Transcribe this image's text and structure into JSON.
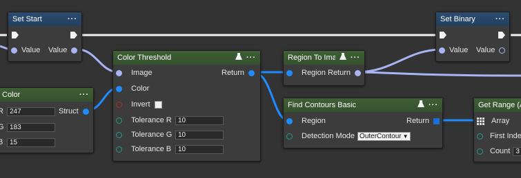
{
  "nodes": {
    "set_start": {
      "title": "Set Start",
      "in_label": "Value",
      "out_label": "Value"
    },
    "set_binary": {
      "title": "Set Binary",
      "in_label": "Value",
      "out_label": "Value"
    },
    "color": {
      "title": "Color",
      "out_label": "Struct",
      "fields": [
        {
          "label": "R",
          "value": "247"
        },
        {
          "label": "G",
          "value": "183"
        },
        {
          "label": "B",
          "value": "15"
        }
      ]
    },
    "color_threshold": {
      "title": "Color Threshold",
      "image_label": "Image",
      "return_label": "Return",
      "color_label": "Color",
      "invert_label": "Invert",
      "tolerances": [
        {
          "label": "Tolerance R",
          "value": "10"
        },
        {
          "label": "Tolerance G",
          "value": "10"
        },
        {
          "label": "Tolerance B",
          "value": "10"
        }
      ]
    },
    "region_to_image": {
      "title": "Region To Image",
      "region_label": "Region",
      "return_label": "Return"
    },
    "find_contours": {
      "title": "Find Contours Basic",
      "region_label": "Region",
      "return_label": "Return",
      "mode_label": "Detection Mode",
      "mode_value": "OuterContour"
    },
    "get_range": {
      "title": "Get Range (Array)",
      "array_label": "Array",
      "first_label": "First Index",
      "count_label": "Count",
      "count_value": "3"
    }
  },
  "colors": {
    "exec_wire": "#f2f2f2",
    "value_wire": "#a9b4f5",
    "region_wire": "#1f8cff",
    "header_blue": "#2c4b6f",
    "header_green": "#3f5f35"
  }
}
